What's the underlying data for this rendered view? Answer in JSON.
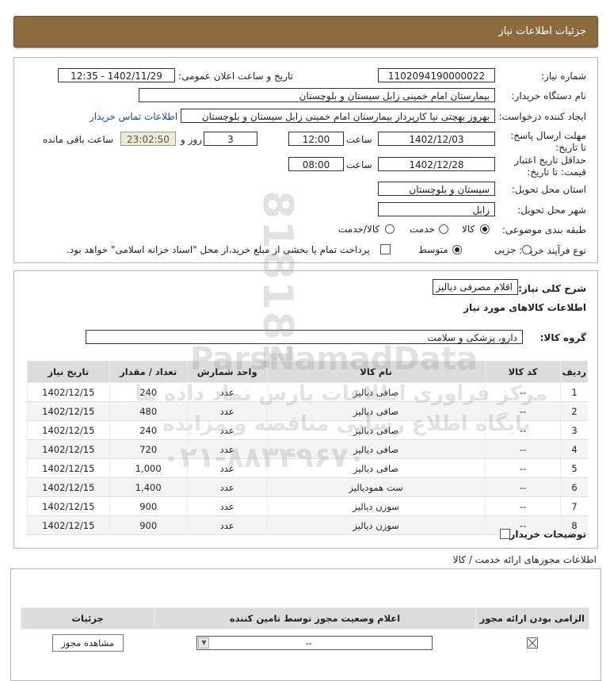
{
  "header": {
    "title": "جزئیات اطلاعات نیاز"
  },
  "details": {
    "need_number_label": "شماره نیاز:",
    "need_number": "1102094190000022",
    "announce_label": "تاریخ و ساعت اعلان عمومی:",
    "announce_value": "1402/11/29 - 12:35",
    "buyer_org_label": "نام دستگاه خریدار:",
    "buyer_org": "بیمارستان امام خمینی زابل سیستان و بلوچستان",
    "creator_label": "ایجاد کننده درخواست:",
    "creator": "بهروز بهچتی نیا کارپرداز بیمارستان امام خمینی زابل سیستان و بلوچستان",
    "contact_link": "اطلاعات تماس خریدار",
    "deadline_label": "مهلت ارسال پاسخ: تا تاریخ:",
    "deadline_date": "1402/12/03",
    "time_label": "ساعت",
    "deadline_time": "12:00",
    "days": "3",
    "days_label": "روز و",
    "remaining": "23:02:50",
    "remaining_label": "ساعت باقی مانده",
    "validity_label": "حداقل تاریخ اعتبار قیمت: تا تاریخ:",
    "validity_date": "1402/12/28",
    "validity_time": "08:00",
    "province_label": "استان محل تحویل:",
    "province": "سیستان و بلوچستان",
    "city_label": "شهر محل تحویل:",
    "city": "زابل",
    "category_label": "طبقه بندی موضوعی:",
    "category_options": [
      "کالا",
      "خدمت",
      "کالا/خدمت"
    ],
    "category_selected": 0,
    "process_label": "نوع فرآیند خرید :",
    "process_options": [
      "جزیی",
      "متوسط"
    ],
    "process_selected": 1,
    "payment_note": "پرداخت تمام یا بخشی از مبلغ خرید،از محل \"اسناد خزانه اسلامی\" خواهد بود."
  },
  "summary": {
    "general_desc_label": "شرح کلی نیاز:",
    "general_desc": "اقلام مصرفی دیالیز",
    "goods_info_title": "اطلاعات کالاهای مورد نیاز",
    "goods_group_label": "گروه کالا:",
    "goods_group": "دارو، پزشکی و سلامت",
    "columns": [
      "ردیف",
      "کد کالا",
      "نام کالا",
      "واحد شمارش",
      "تعداد / مقدار",
      "تاریخ نیاز"
    ],
    "rows": [
      [
        "1",
        "--",
        "صافی دیالیز",
        "عدد",
        "240",
        "1402/12/15"
      ],
      [
        "2",
        "--",
        "صافی دیالیز",
        "عدد",
        "480",
        "1402/12/15"
      ],
      [
        "3",
        "--",
        "صافی دیالیز",
        "عدد",
        "240",
        "1402/12/15"
      ],
      [
        "4",
        "--",
        "صافی دیالیز",
        "عدد",
        "720",
        "1402/12/15"
      ],
      [
        "5",
        "--",
        "صافی دیالیز",
        "عدد",
        "1,000",
        "1402/12/15"
      ],
      [
        "6",
        "--",
        "ست همودیالیز",
        "عدد",
        "1,400",
        "1402/12/15"
      ],
      [
        "7",
        "--",
        "سوزن دیالیز",
        "عدد",
        "900",
        "1402/12/15"
      ],
      [
        "8",
        "--",
        "سوزن دیالیز",
        "عدد",
        "900",
        "1402/12/15"
      ]
    ],
    "buyer_notes_label": "توضیحات خریدار:"
  },
  "licenses": {
    "title": "اطلاعات مجوزهای ارائه خدمت / کالا",
    "columns": [
      "الزامی بودن ارائه مجوز",
      "اعلام وضعیت مجوز توسط تامین کننده",
      "جزئیات"
    ],
    "select_value": "--",
    "view_button": "مشاهده مجوز"
  },
  "watermark": {
    "brand": "ParsNamadData",
    "line1": "مرکز فراوری اطلاعات پارس نماد داده ها",
    "line2": "پایگاه اطلاع رسانی مناقصه و مزایده",
    "phone": "۰۲۱-۸۸۳۴۹۶۷۰",
    "digits": "818181"
  },
  "colors": {
    "header_bg": "#8c6a3e",
    "table_header_bg": "#dcdcdc",
    "link": "#1a4a9c"
  }
}
